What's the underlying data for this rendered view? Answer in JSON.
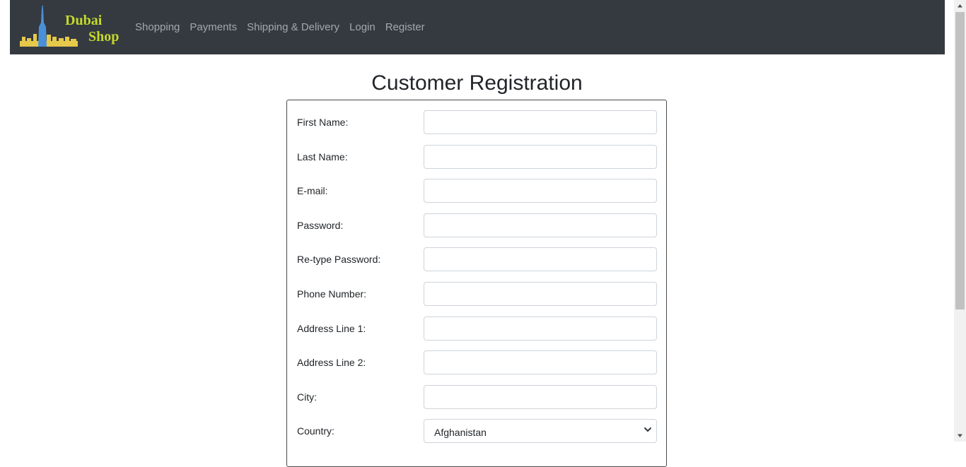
{
  "brand": {
    "line1": "Dubai",
    "line2": "Shop",
    "text_color": "#c5d92b",
    "bar_color": "#343a40"
  },
  "nav": {
    "links": [
      {
        "label": "Shopping"
      },
      {
        "label": "Payments"
      },
      {
        "label": "Shipping & Delivery"
      },
      {
        "label": "Login"
      },
      {
        "label": "Register"
      }
    ]
  },
  "page": {
    "title": "Customer Registration"
  },
  "form": {
    "fields": [
      {
        "label": "First Name:",
        "value": ""
      },
      {
        "label": "Last Name:",
        "value": ""
      },
      {
        "label": "E-mail:",
        "value": ""
      },
      {
        "label": "Password:",
        "value": ""
      },
      {
        "label": "Re-type Password:",
        "value": ""
      },
      {
        "label": "Phone Number:",
        "value": ""
      },
      {
        "label": "Address Line 1:",
        "value": ""
      },
      {
        "label": "Address Line 2:",
        "value": ""
      },
      {
        "label": "City:",
        "value": ""
      }
    ],
    "country": {
      "label": "Country:",
      "selected": "Afghanistan"
    }
  }
}
